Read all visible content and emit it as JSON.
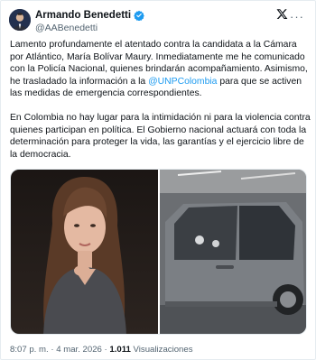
{
  "author": {
    "display_name": "Armando Benedetti",
    "handle": "@AABenedetti"
  },
  "tweet": {
    "p1_before_mention": "Lamento profundamente el atentado contra la candidata a la Cámara por Atlántico, María Bolívar Maury. Inmediatamente me he comunicado con la Policía Nacional, quienes brindarán acompañamiento. Asimismo, he trasladado la información a la ",
    "p1_mention": "@UNPColombia",
    "p1_after_mention": " para que se activen las medidas de emergencia correspondientes.",
    "p2": "En Colombia no hay lugar para la intimidación ni para la violencia contra quienes participan en política. El Gobierno nacional actuará con toda la determinación para proteger la vida, las garantías y el ejercicio libre de la democracia."
  },
  "footer": {
    "time": "8:07 p. m.",
    "separator": " · ",
    "date": "4 mar. 2026",
    "views_count": "1.011",
    "views_label": " Visualizaciones"
  },
  "colors": {
    "accent": "#1d9bf0",
    "text": "#0f1419",
    "muted": "#536471"
  },
  "icons": {
    "verified": "verified-badge-icon",
    "platform": "x-logo-icon",
    "more": "more-options-icon"
  }
}
